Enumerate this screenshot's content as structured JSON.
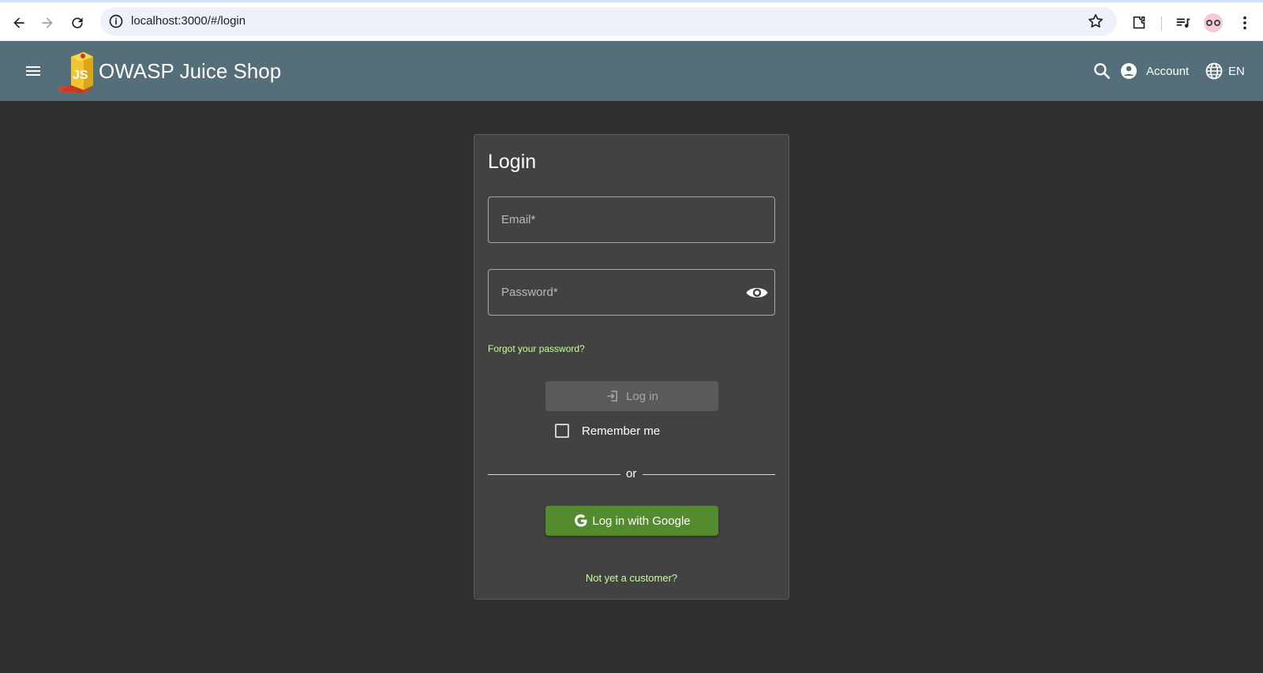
{
  "browser": {
    "url": "localhost:3000/#/login"
  },
  "toolbar": {
    "app_title": "OWASP Juice Shop",
    "logo_text": "JS",
    "account_label": "Account",
    "language_label": "EN"
  },
  "login": {
    "title": "Login",
    "email_placeholder": "Email*",
    "password_placeholder": "Password*",
    "forgot_password": "Forgot your password?",
    "login_button": "Log in",
    "remember_me": "Remember me",
    "or_text": "or",
    "google_button": "Log in with Google",
    "register_link": "Not yet a customer?"
  },
  "colors": {
    "toolbar_bg": "#546e7a",
    "page_bg": "#303030",
    "card_bg": "#424242",
    "link_green": "#c6ff9d",
    "google_btn": "#558b2f"
  }
}
